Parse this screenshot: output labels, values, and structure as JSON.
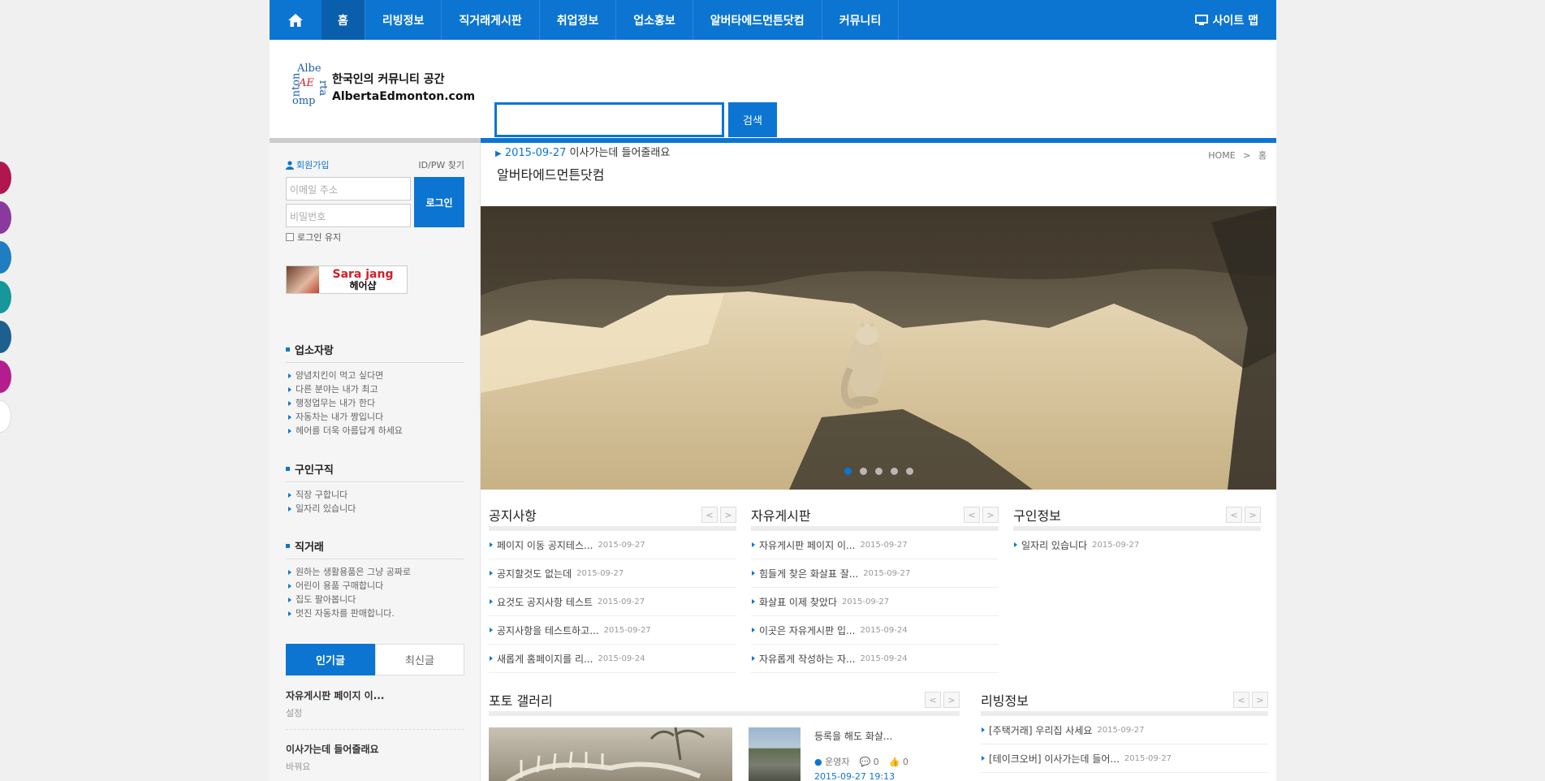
{
  "nav": {
    "items": [
      {
        "label": "홈",
        "active": true
      },
      {
        "label": "리빙정보"
      },
      {
        "label": "직거래게시판"
      },
      {
        "label": "취업정보"
      },
      {
        "label": "업소홍보"
      },
      {
        "label": "알버타에드먼튼닷컴"
      },
      {
        "label": "커뮤니티"
      }
    ],
    "sitemap": "사이트 맵",
    "home_icon": "home-icon",
    "sitemap_icon": "monitor-icon"
  },
  "logo": {
    "tagline": "한국인의 커뮤니티 공간",
    "domain": "AlbertaEdmonton.com"
  },
  "search": {
    "value": "",
    "button": "검색"
  },
  "notice": {
    "date": "2015-09-27",
    "text": "이사가는데 들어줄래요"
  },
  "login": {
    "join": "회원가입",
    "find": "ID/PW 찾기",
    "email_placeholder": "이메일 주소",
    "password_placeholder": "비밀번호",
    "button": "로그인",
    "keep": "로그인 유지"
  },
  "banner": {
    "line1": "Sara jang",
    "line2": "헤어샵"
  },
  "sidebar_sections": [
    {
      "title": "업소자랑",
      "items": [
        "양념치킨이 먹고 싶다면",
        "다른 분야는 내가 최고",
        "행정업무는 내가 한다",
        "자동차는 내가 짱입니다",
        "헤어를 더욱 아름답게 하세요"
      ]
    },
    {
      "title": "구인구직",
      "items": [
        "직장 구합니다",
        "일자리 있습니다"
      ]
    },
    {
      "title": "직거래",
      "items": [
        "원하는 생활용품은 그냥 공짜로",
        "어린이 용품 구매합니다",
        "집도 팔아봅니다",
        "멋진 자동차를 판매합니다."
      ]
    }
  ],
  "tabs": {
    "popular": "인기글",
    "latest": "최신글"
  },
  "popular_posts": [
    {
      "title": "자유게시판 페이지 이...",
      "category": "설정"
    },
    {
      "title": "이사가는데 들어줄래요",
      "category": "바꿔요"
    }
  ],
  "breadcrumb": {
    "home": "HOME",
    "sep": ">",
    "current": "홈"
  },
  "page_title": "알버타에드먼튼닷컴",
  "slider": {
    "dots": 5,
    "active": 0
  },
  "boards": [
    {
      "title": "공지사항",
      "posts": [
        {
          "title": "페이지 이동 공지테스...",
          "date": "2015-09-27"
        },
        {
          "title": "공지할것도 없는데",
          "date": "2015-09-27"
        },
        {
          "title": "요것도 공지사항 테스트",
          "date": "2015-09-27"
        },
        {
          "title": "공지사항을 테스트하고...",
          "date": "2015-09-27"
        },
        {
          "title": "새롭게 홈페이지를 리...",
          "date": "2015-09-24"
        }
      ]
    },
    {
      "title": "자유게시판",
      "posts": [
        {
          "title": "자유게시판 페이지 이...",
          "date": "2015-09-27"
        },
        {
          "title": "힘들게 찾은 화살표 잘...",
          "date": "2015-09-27"
        },
        {
          "title": "화살표 이제 찾았다",
          "date": "2015-09-27"
        },
        {
          "title": "이곳은 자유게시판 입...",
          "date": "2015-09-24"
        },
        {
          "title": "자유롭게 작성하는 자...",
          "date": "2015-09-24"
        }
      ]
    },
    {
      "title": "구인정보",
      "posts": [
        {
          "title": "일자리 있습니다",
          "date": "2015-09-27"
        }
      ]
    }
  ],
  "gallery": {
    "title": "포토 갤러리",
    "item_title": "등록을 해도 화살...",
    "author": "운영자",
    "comments": "0",
    "likes": "0",
    "datetime": "2015-09-27 19:13"
  },
  "living": {
    "title": "리빙정보",
    "posts": [
      {
        "title": "[주택거래] 우리집 사세요",
        "date": "2015-09-27"
      },
      {
        "title": "[테이크오버] 이사가는데 들어...",
        "date": "2015-09-27"
      }
    ]
  },
  "colors": {
    "accent": "#0b75d1",
    "side_dots": [
      "#b0174d",
      "#8a3a9e",
      "#1f7ec2",
      "#16979b",
      "#1d5f8f",
      "#b51d8e",
      "#ffffff"
    ]
  }
}
